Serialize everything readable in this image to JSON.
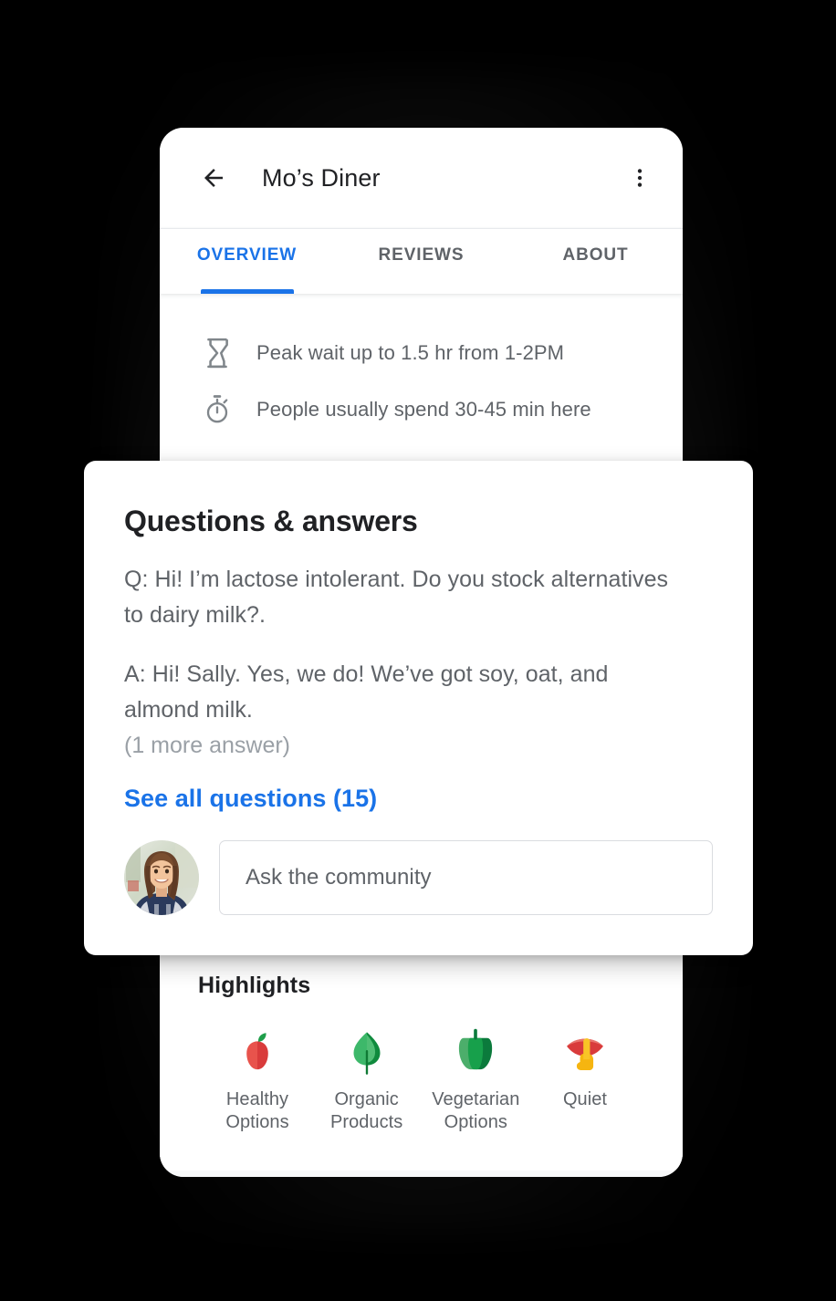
{
  "appbar": {
    "back_icon": "back-arrow-icon",
    "title": "Mo’s Diner",
    "overflow_icon": "more-vert-icon"
  },
  "tabs": [
    {
      "label": "OVERVIEW",
      "active": true
    },
    {
      "label": "REVIEWS",
      "active": false
    },
    {
      "label": "ABOUT",
      "active": false
    }
  ],
  "info_rows": [
    {
      "icon": "hourglass-icon",
      "text": "Peak wait up to 1.5 hr from 1-2PM"
    },
    {
      "icon": "stopwatch-icon",
      "text": "People usually spend 30-45 min here"
    }
  ],
  "qa_card": {
    "title": "Questions & answers",
    "question": "Q: Hi! I’m lactose intolerant. Do you stock alternatives to dairy milk?.",
    "answer": "A: Hi! Sally. Yes, we do! We’ve got soy, oat, and almond milk.",
    "more_answers": "(1 more answer)",
    "see_all_link": "See all questions (15)",
    "avatar_icon": "user-avatar-photo",
    "ask_placeholder": "Ask the community"
  },
  "highlights": {
    "title": "Highlights",
    "items": [
      {
        "icon": "apple-icon",
        "label": "Healthy\nOptions",
        "line1": "Healthy",
        "line2": "Options"
      },
      {
        "icon": "leaf-icon",
        "label": "Organic\nProducts",
        "line1": "Organic",
        "line2": "Products"
      },
      {
        "icon": "bell-pepper-icon",
        "label": "Vegetarian\nOptions",
        "line1": "Vegetarian",
        "line2": "Options"
      },
      {
        "icon": "shushing-icon",
        "label": "Quiet",
        "line1": "Quiet",
        "line2": ""
      }
    ]
  },
  "colors": {
    "accent_blue": "#1a73e8",
    "text_primary": "#202124",
    "text_secondary": "#5f6368",
    "text_muted": "#9aa0a6",
    "page_background": "#000000",
    "surface": "#ffffff",
    "surface_alt": "#f8f9fa"
  }
}
